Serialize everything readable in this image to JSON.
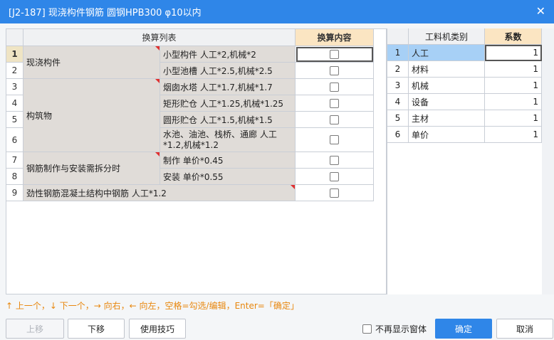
{
  "window": {
    "title": "[J2-187] 现浇构件钢筋 圆钢HPB300 φ10以内",
    "close_glyph": "✕"
  },
  "left_table": {
    "header_list": "换算列表",
    "header_content": "换算内容",
    "row_numbers": [
      "1",
      "2",
      "3",
      "4",
      "5",
      "6",
      "7",
      "8",
      "9"
    ],
    "groups": [
      "现浇构件",
      "构筑物",
      "钢筋制作与安装需拆分时",
      "劲性钢筋混凝土结构中钢筋 人工*1.2"
    ],
    "items": [
      "小型构件 人工*2,机械*2",
      "小型池槽 人工*2.5,机械*2.5",
      "烟囱水塔 人工*1.7,机械*1.7",
      "矩形贮仓 人工*1.25,机械*1.25",
      "圆形贮仓 人工*1.5,机械*1.5",
      "水池、油池、栈桥、通廊 人工*1.2,机械*1.2",
      "制作 单价*0.45",
      "安装 单价*0.55"
    ]
  },
  "right_table": {
    "header_category": "工料机类别",
    "header_coef": "系数",
    "rows": [
      {
        "no": "1",
        "name": "人工",
        "coef": "1"
      },
      {
        "no": "2",
        "name": "材料",
        "coef": "1"
      },
      {
        "no": "3",
        "name": "机械",
        "coef": "1"
      },
      {
        "no": "4",
        "name": "设备",
        "coef": "1"
      },
      {
        "no": "5",
        "name": "主材",
        "coef": "1"
      },
      {
        "no": "6",
        "name": "单价",
        "coef": "1"
      }
    ]
  },
  "hint": "↑ 上一个，↓ 下一个，→ 向右，← 向左，空格=勾选/编辑，Enter=「确定」",
  "buttons": {
    "up": "上移",
    "down": "下移",
    "tips": "使用技巧",
    "ok": "确定",
    "cancel": "取消"
  },
  "dont_show": "不再显示窗体",
  "colors": {
    "title_bar": "#2f86e8",
    "hint": "#e8870e",
    "header_gold": "#fbe5c2",
    "selected_row": "#a7d0f6"
  }
}
